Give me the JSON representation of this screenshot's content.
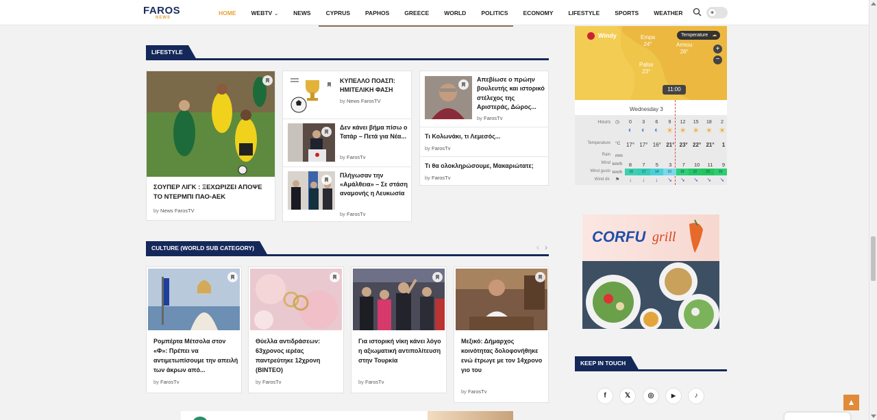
{
  "header": {
    "logo_main": "FAROS",
    "logo_sub": "NEWS",
    "nav": [
      {
        "label": "HOME",
        "active": true
      },
      {
        "label": "WEBTV",
        "dropdown": true
      },
      {
        "label": "NEWS"
      },
      {
        "label": "CYPRUS"
      },
      {
        "label": "PAPHOS"
      },
      {
        "label": "GREECE"
      },
      {
        "label": "WORLD"
      },
      {
        "label": "POLITICS"
      },
      {
        "label": "ECONOMY"
      },
      {
        "label": "LIFESTYLE"
      },
      {
        "label": "SPORTS"
      },
      {
        "label": "WEATHER"
      }
    ],
    "toggle_icon": "sun-icon"
  },
  "lifestyle": {
    "heading": "LIFESTYLE",
    "featured": {
      "title": "ΣΟΥΠΕΡ ΛΙΓΚ : ΞΕΧΩΡΙΖΕΙ ΑΠΟΨΕ ΤΟ ΝΤΕΡΜΠΙ ΠΑΟ-ΑΕΚ",
      "by": "by",
      "author": "News FarosTV"
    },
    "middle": [
      {
        "title": "ΚΥΠΕΛΛΟ ΠΟΑΣΠ: ΗΜΙΤΕΛΙΚΗ ΦΑΣΗ",
        "by": "by",
        "author": "News FarosTV"
      },
      {
        "title": "Δεν κάνει βήμα πίσω ο Τατάρ – Πετά για Νέα...",
        "by": "by",
        "author": "FarosTv"
      },
      {
        "title": "Πλήγωσαν την «Αμάλθεια» – Σε στάση αναμονής η Λευκωσία",
        "by": "by",
        "author": "FarosTv"
      }
    ],
    "right": [
      {
        "title": "Απεβίωσε ο πρώην βουλευτής και ιστορικό στέλεχος της Αριστεράς, Δώρος...",
        "by": "by",
        "author": "FarosTv"
      },
      {
        "title": "Τι Κολωνάκι, τι Λεμεσός...",
        "by": "by",
        "author": "FarosTv"
      },
      {
        "title": "Τι θα ολοκληρώσουμε, Μακαριώτατε;",
        "by": "by",
        "author": "FarosTv"
      }
    ]
  },
  "culture": {
    "heading": "CULTURE (WORLD SUB CATEGORY)",
    "prev": "‹",
    "next": "›",
    "cards": [
      {
        "title": "Ρομπέρτα Μέτσολα στον «Φ»: Πρέπει να αντιμετωπίσουμε την απειλή των άκρων από...",
        "by": "by",
        "author": "FarosTv"
      },
      {
        "title": "Θύελλα αντιδράσεων: 63χρονος ιερέας παντρεύτηκε 12χρονη (ΒΙΝΤΕΟ)",
        "by": "by",
        "author": "FarosTv"
      },
      {
        "title": "Για ιστορική νίκη κάνει λόγο η αξιωματική αντιπολίτευση στην Τουρκία",
        "by": "by",
        "author": "FarosTv"
      },
      {
        "title": "Μεξικό: Δήμαρχος κοινότητας δολοφονήθηκε ενώ έτρωγε με τον 14χρονο γιο του",
        "by": "by",
        "author": "FarosTv"
      }
    ]
  },
  "weather": {
    "brand": "Windy",
    "layer": "Temperature",
    "places": [
      {
        "name": "Empa",
        "temp": "24°"
      },
      {
        "name": "Armou",
        "temp": "26°"
      },
      {
        "name": "Pafos",
        "temp": "23°"
      }
    ],
    "time": "11:00",
    "day": "Wednesday 3",
    "rows": {
      "hours_label": "Hours",
      "hours": [
        "0",
        "3",
        "6",
        "9",
        "12",
        "15",
        "18",
        "2"
      ],
      "temperature_label": "Temperature",
      "temperature_unit": "°C",
      "temperature": [
        "17°",
        "17°",
        "16°",
        "21°",
        "23°",
        "22°",
        "21°",
        "1"
      ],
      "rain_label": "Rain",
      "rain_unit": "mm",
      "wind_label": "Wind",
      "wind_unit": "km/h",
      "wind": [
        "8",
        "7",
        "5",
        "3",
        "7",
        "10",
        "11",
        "9"
      ],
      "gusts_label": "Wind gusts",
      "gusts_unit": "km/h",
      "gusts": [
        "16",
        "17",
        "14",
        "10",
        "18",
        "22",
        "23",
        "20"
      ],
      "dir_label": "Wind dir."
    }
  },
  "ad": {
    "brand": "CORFU",
    "brand2": "grill"
  },
  "keep_in_touch": {
    "heading": "KEEP IN TOUCH",
    "icons": [
      "facebook-icon",
      "x-icon",
      "instagram-icon",
      "youtube-icon",
      "tiktok-icon"
    ],
    "glyphs": [
      "f",
      "𝕏",
      "◎",
      "▶",
      "♪"
    ]
  },
  "back_to_top": "▲"
}
